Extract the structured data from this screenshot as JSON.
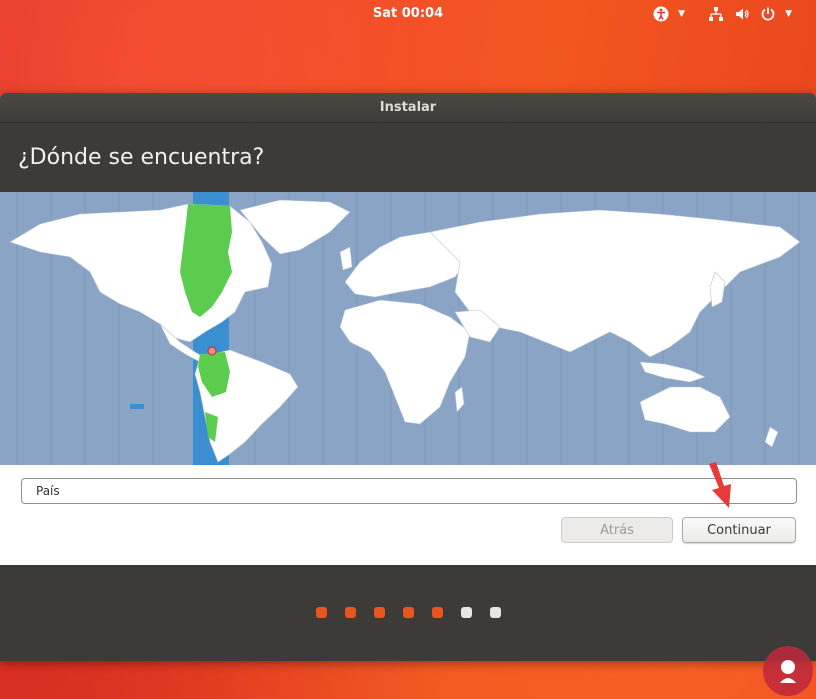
{
  "top_panel": {
    "clock": "Sat 00:04",
    "icons": [
      "accessibility-icon",
      "network-icon",
      "volume-icon",
      "power-icon"
    ]
  },
  "window": {
    "title": "Instalar",
    "heading": "¿Dónde se encuentra?"
  },
  "map": {
    "ocean_color": "#8aa4c6",
    "land_color": "#ffffff",
    "selected_zone_color": "#3a8fd0",
    "selected_region_color": "#5ccc4f"
  },
  "form": {
    "country_value": "País",
    "back_label": "Atrás",
    "continue_label": "Continuar"
  },
  "progress": {
    "total_steps": 7,
    "completed_steps": 5,
    "active_color": "#e95420",
    "inactive_color": "#e6e6e6"
  }
}
